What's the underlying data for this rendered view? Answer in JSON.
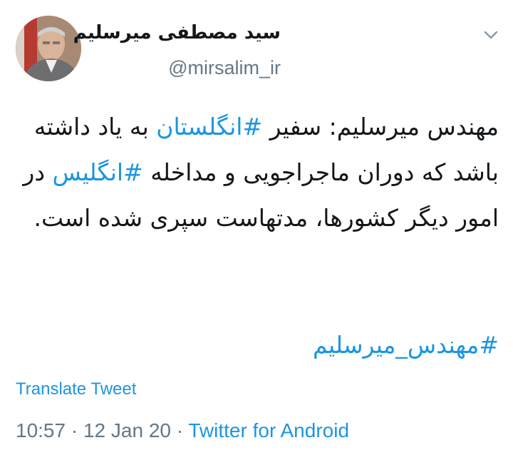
{
  "header": {
    "display_name": "سید مصطفی میرسلیم",
    "handle": "@mirsalim_ir"
  },
  "tweet": {
    "segments": [
      {
        "text": "مهندس میرسلیم: سفیر ",
        "hashtag": false
      },
      {
        "text": "#انگلستان",
        "hashtag": true
      },
      {
        "text": " به یاد داشته باشد که دوران ماجراجویی و مداخله ",
        "hashtag": false
      },
      {
        "text": "#انگلیس",
        "hashtag": true
      },
      {
        "text": " در امور دیگر کشورها، مدتهاست سپری شده است.",
        "hashtag": false
      }
    ],
    "tag_line": "#مهندس_میرسلیم"
  },
  "translate_label": "Translate Tweet",
  "meta": {
    "time": "10:57",
    "separator1": " · ",
    "date": "12 Jan 20",
    "separator2": " · ",
    "source": "Twitter for Android"
  },
  "colors": {
    "link": "#1b95e0",
    "secondary_text": "#657786",
    "primary_text": "#14171a"
  },
  "icons": {
    "menu": "chevron-down-icon",
    "avatar": "profile-photo"
  }
}
